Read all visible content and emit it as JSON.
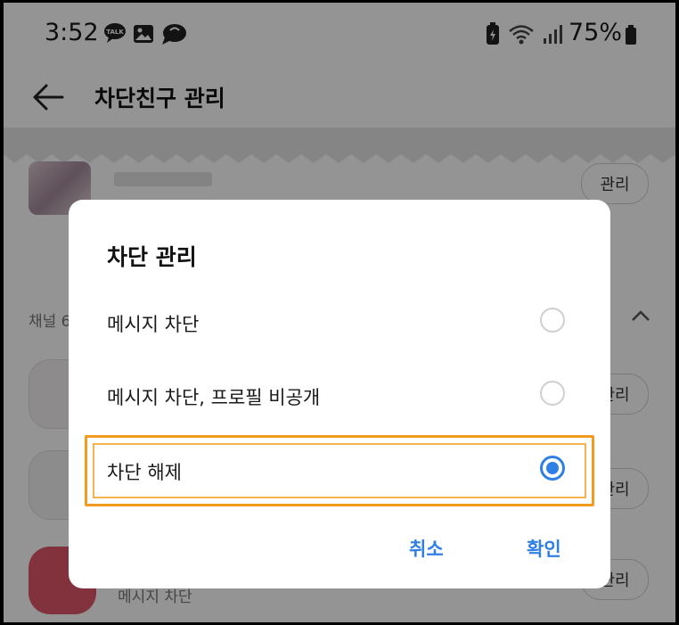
{
  "status_bar": {
    "time": "3:52",
    "battery_percent": "75%",
    "left_icons": [
      "talk-notification-icon",
      "gallery-icon",
      "chat-bubble-icon"
    ],
    "right_icons": [
      "battery-saver-icon",
      "wifi-icon",
      "signal-icon",
      "battery-icon"
    ]
  },
  "header": {
    "back_icon": "back-arrow-icon",
    "title": "차단친구 관리"
  },
  "background_list": {
    "manage_label": "관리",
    "section_label": "채널 6",
    "last_row_subtext": "메시지 차단"
  },
  "dialog": {
    "title": "차단 관리",
    "options": [
      {
        "label": "메시지 차단",
        "selected": false
      },
      {
        "label": "메시지 차단, 프로필 비공개",
        "selected": false
      },
      {
        "label": "차단 해제",
        "selected": true
      }
    ],
    "cancel_label": "취소",
    "confirm_label": "확인"
  },
  "colors": {
    "accent": "#2f7fe6",
    "highlight": "#f39a20"
  }
}
